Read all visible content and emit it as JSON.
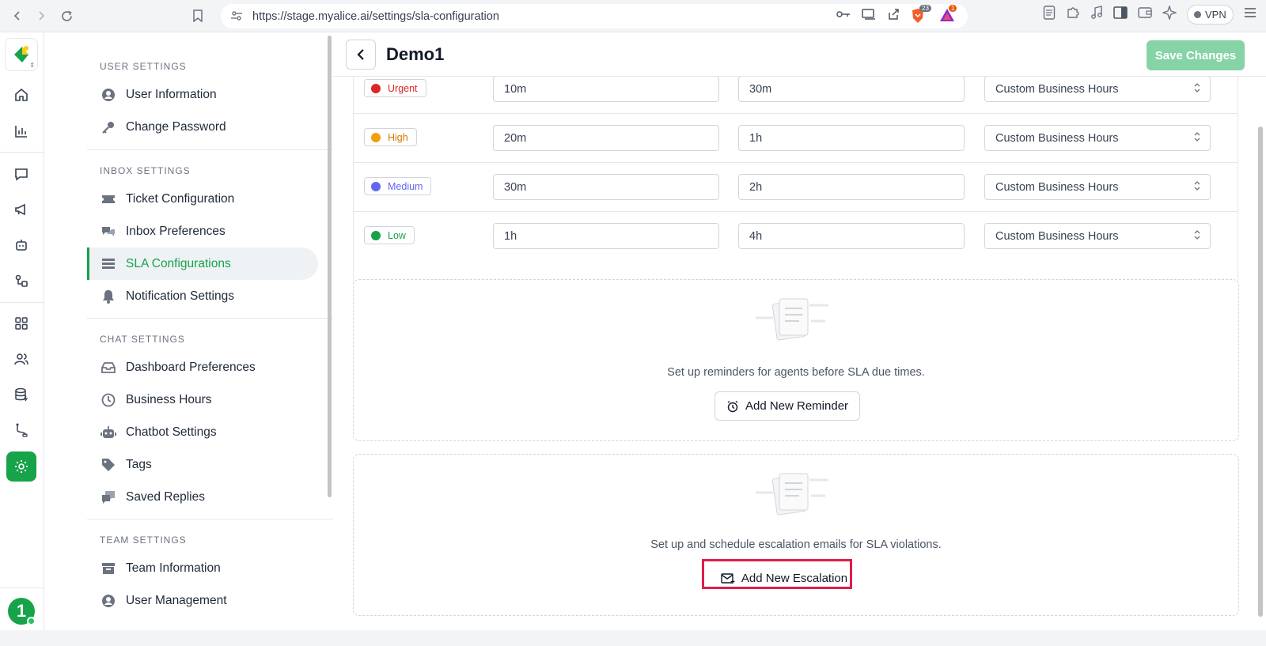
{
  "browser": {
    "url": "https://stage.myalice.ai/settings/sla-configuration",
    "brave_count": "23",
    "alert_count": "1",
    "vpn_label": "VPN"
  },
  "rail": {
    "avatar_label": "1"
  },
  "sidebar": {
    "sections": [
      {
        "title": "USER SETTINGS",
        "items": [
          {
            "label": "User Information",
            "icon": "user-circle-icon"
          },
          {
            "label": "Change Password",
            "icon": "key-icon"
          }
        ]
      },
      {
        "title": "INBOX SETTINGS",
        "items": [
          {
            "label": "Ticket Configuration",
            "icon": "ticket-icon"
          },
          {
            "label": "Inbox Preferences",
            "icon": "chat-bubbles-icon"
          },
          {
            "label": "SLA Configurations",
            "icon": "list-icon",
            "active": true
          },
          {
            "label": "Notification Settings",
            "icon": "bell-icon"
          }
        ]
      },
      {
        "title": "CHAT SETTINGS",
        "items": [
          {
            "label": "Dashboard Preferences",
            "icon": "inbox-icon"
          },
          {
            "label": "Business Hours",
            "icon": "clock-icon"
          },
          {
            "label": "Chatbot Settings",
            "icon": "robot-icon"
          },
          {
            "label": "Tags",
            "icon": "tag-icon"
          },
          {
            "label": "Saved Replies",
            "icon": "reply-icon"
          }
        ]
      },
      {
        "title": "TEAM SETTINGS",
        "items": [
          {
            "label": "Team Information",
            "icon": "archive-icon"
          },
          {
            "label": "User Management",
            "icon": "user-circle-icon"
          }
        ]
      }
    ]
  },
  "header": {
    "title": "Demo1",
    "save_label": "Save Changes"
  },
  "priorities": [
    {
      "label": "Urgent",
      "color": "#dc2626",
      "text_color": "#dc2626",
      "first_response": "10m",
      "resolution": "30m",
      "hours": "Custom Business Hours"
    },
    {
      "label": "High",
      "color": "#f59e0b",
      "text_color": "#d97706",
      "first_response": "20m",
      "resolution": "1h",
      "hours": "Custom Business Hours"
    },
    {
      "label": "Medium",
      "color": "#6366f1",
      "text_color": "#6366f1",
      "first_response": "30m",
      "resolution": "2h",
      "hours": "Custom Business Hours"
    },
    {
      "label": "Low",
      "color": "#16a34a",
      "text_color": "#16a34a",
      "first_response": "1h",
      "resolution": "4h",
      "hours": "Custom Business Hours"
    }
  ],
  "reminder": {
    "text": "Set up reminders for agents before SLA due times.",
    "button_label": "Add New Reminder"
  },
  "escalation": {
    "text": "Set up and schedule escalation emails for SLA violations.",
    "button_label": "Add New Escalation"
  }
}
